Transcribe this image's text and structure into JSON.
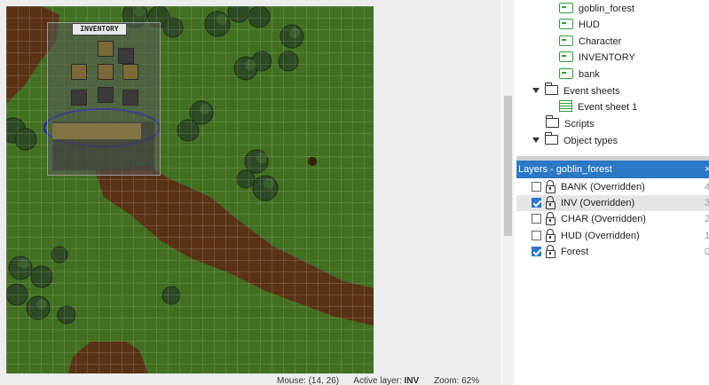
{
  "canvas": {
    "inventory_title": "INVENTORY"
  },
  "statusbar": {
    "mouse": "Mouse: (14, 26)",
    "active_layer_label": "Active layer:",
    "active_layer": "INV",
    "zoom": "Zoom: 62%"
  },
  "project": {
    "items": [
      {
        "label": "goblin_forest",
        "type": "layout"
      },
      {
        "label": "HUD",
        "type": "layout"
      },
      {
        "label": "Character",
        "type": "layout"
      },
      {
        "label": "INVENTORY",
        "type": "layout"
      },
      {
        "label": "bank",
        "type": "layout"
      },
      {
        "label": "Event sheets",
        "type": "folder-expanded"
      },
      {
        "label": "Event sheet 1",
        "type": "event-sheet"
      },
      {
        "label": "Scripts",
        "type": "folder"
      },
      {
        "label": "Object types",
        "type": "folder-expanded"
      }
    ]
  },
  "layers": {
    "title": "Layers - goblin_forest",
    "close": "×",
    "rows": [
      {
        "name": "BANK (Overridden)",
        "checked": false,
        "index": "4",
        "selected": false
      },
      {
        "name": "INV (Overridden)",
        "checked": true,
        "index": "3",
        "selected": true
      },
      {
        "name": "CHAR (Overridden)",
        "checked": false,
        "index": "2",
        "selected": false
      },
      {
        "name": "HUD (Overridden)",
        "checked": false,
        "index": "1",
        "selected": false
      },
      {
        "name": "Forest",
        "checked": true,
        "index": "0",
        "selected": false
      }
    ]
  },
  "colors": {
    "grass": "#3f6b1f",
    "dirt": "#5a3216",
    "selection_header": "#2b78c6",
    "annotation_circle": "#1d1dcf"
  },
  "icons": [
    "layout-icon",
    "folder-icon",
    "event-sheet-icon",
    "checkbox-icon",
    "lock-icon",
    "expand-caret-icon"
  ]
}
